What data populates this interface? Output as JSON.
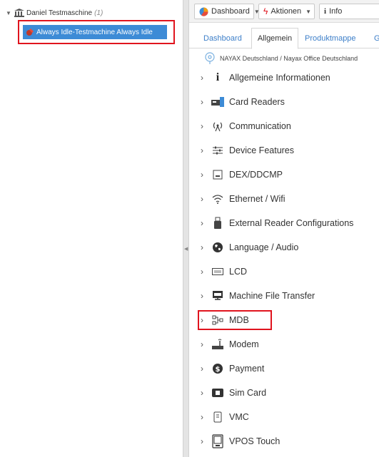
{
  "tree": {
    "root": {
      "label": "Daniel Testmaschine",
      "count": "(1)"
    },
    "selected": {
      "label": "Always Idle-Testmachine Always Idle"
    }
  },
  "toolbar": {
    "dashboard_label": "Dashboard",
    "aktionen_label": "Aktionen",
    "info_label": "Info"
  },
  "tabs": {
    "dashboard": "Dashboard",
    "allgemein": "Allgemein",
    "produktmappe": "Produktmappe",
    "more": "G"
  },
  "breadcrumb": "NAYAX Deutschland / Nayax Office Deutschland",
  "categories": [
    {
      "label": "Allgemeine Informationen",
      "icon": "info-icon"
    },
    {
      "label": "Card Readers",
      "icon": "card-reader-icon"
    },
    {
      "label": "Communication",
      "icon": "antenna-icon"
    },
    {
      "label": "Device Features",
      "icon": "sliders-icon"
    },
    {
      "label": "DEX/DDCMP",
      "icon": "dex-icon"
    },
    {
      "label": "Ethernet / Wifi",
      "icon": "wifi-icon"
    },
    {
      "label": "External Reader Configurations",
      "icon": "usb-reader-icon"
    },
    {
      "label": "Language / Audio",
      "icon": "globe-icon"
    },
    {
      "label": "LCD",
      "icon": "lcd-icon"
    },
    {
      "label": "Machine File Transfer",
      "icon": "ftp-icon"
    },
    {
      "label": "MDB",
      "icon": "network-nodes-icon"
    },
    {
      "label": "Modem",
      "icon": "modem-icon"
    },
    {
      "label": "Payment",
      "icon": "dollar-circle-icon"
    },
    {
      "label": "Sim Card",
      "icon": "sim-card-icon"
    },
    {
      "label": "VMC",
      "icon": "vmc-icon"
    },
    {
      "label": "VPOS Touch",
      "icon": "vpos-touch-icon"
    }
  ],
  "colors": {
    "selection": "#3d8bd6",
    "highlight_border": "#e0141e",
    "link": "#3d7fc9"
  }
}
